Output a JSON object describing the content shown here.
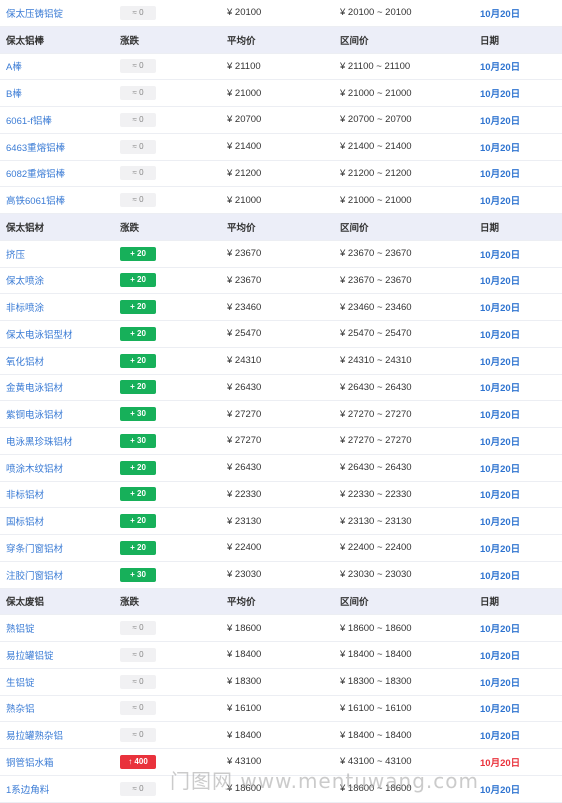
{
  "sections": [
    {
      "header": null,
      "rows": [
        {
          "name": "保太压铸铝锭",
          "change": "0",
          "dir": "flat",
          "avg": "¥ 20100",
          "range": "¥ 20100 ~ 20100",
          "date": "10月20日"
        }
      ]
    },
    {
      "header": {
        "name": "保太铝棒",
        "change": "涨跌",
        "avg": "平均价",
        "range": "区间价",
        "date": "日期"
      },
      "rows": [
        {
          "name": "A棒",
          "change": "0",
          "dir": "flat",
          "avg": "¥ 21100",
          "range": "¥ 21100 ~ 21100",
          "date": "10月20日"
        },
        {
          "name": "B棒",
          "change": "0",
          "dir": "flat",
          "avg": "¥ 21000",
          "range": "¥ 21000 ~ 21000",
          "date": "10月20日"
        },
        {
          "name": "6061-f铝棒",
          "change": "0",
          "dir": "flat",
          "avg": "¥ 20700",
          "range": "¥ 20700 ~ 20700",
          "date": "10月20日"
        },
        {
          "name": "6463重熔铝棒",
          "change": "0",
          "dir": "flat",
          "avg": "¥ 21400",
          "range": "¥ 21400 ~ 21400",
          "date": "10月20日"
        },
        {
          "name": "6082重熔铝棒",
          "change": "0",
          "dir": "flat",
          "avg": "¥ 21200",
          "range": "¥ 21200 ~ 21200",
          "date": "10月20日"
        },
        {
          "name": "高铁6061铝棒",
          "change": "0",
          "dir": "flat",
          "avg": "¥ 21000",
          "range": "¥ 21000 ~ 21000",
          "date": "10月20日"
        }
      ]
    },
    {
      "header": {
        "name": "保太铝材",
        "change": "涨跌",
        "avg": "平均价",
        "range": "区间价",
        "date": "日期"
      },
      "rows": [
        {
          "name": "挤压",
          "change": "+ 20",
          "dir": "up",
          "avg": "¥ 23670",
          "range": "¥ 23670 ~ 23670",
          "date": "10月20日"
        },
        {
          "name": "保太喷涂",
          "change": "+ 20",
          "dir": "up",
          "avg": "¥ 23670",
          "range": "¥ 23670 ~ 23670",
          "date": "10月20日"
        },
        {
          "name": "非标喷涂",
          "change": "+ 20",
          "dir": "up",
          "avg": "¥ 23460",
          "range": "¥ 23460 ~ 23460",
          "date": "10月20日"
        },
        {
          "name": "保太电泳铝型材",
          "change": "+ 20",
          "dir": "up",
          "avg": "¥ 25470",
          "range": "¥ 25470 ~ 25470",
          "date": "10月20日"
        },
        {
          "name": "氧化铝材",
          "change": "+ 20",
          "dir": "up",
          "avg": "¥ 24310",
          "range": "¥ 24310 ~ 24310",
          "date": "10月20日"
        },
        {
          "name": "金黄电泳铝材",
          "change": "+ 20",
          "dir": "up",
          "avg": "¥ 26430",
          "range": "¥ 26430 ~ 26430",
          "date": "10月20日"
        },
        {
          "name": "紫铜电泳铝材",
          "change": "+ 30",
          "dir": "up",
          "avg": "¥ 27270",
          "range": "¥ 27270 ~ 27270",
          "date": "10月20日"
        },
        {
          "name": "电泳黑珍珠铝材",
          "change": "+ 30",
          "dir": "up",
          "avg": "¥ 27270",
          "range": "¥ 27270 ~ 27270",
          "date": "10月20日"
        },
        {
          "name": "喷涂木纹铝材",
          "change": "+ 20",
          "dir": "up",
          "avg": "¥ 26430",
          "range": "¥ 26430 ~ 26430",
          "date": "10月20日"
        },
        {
          "name": "非标铝材",
          "change": "+ 20",
          "dir": "up",
          "avg": "¥ 22330",
          "range": "¥ 22330 ~ 22330",
          "date": "10月20日"
        },
        {
          "name": "国标铝材",
          "change": "+ 20",
          "dir": "up",
          "avg": "¥ 23130",
          "range": "¥ 23130 ~ 23130",
          "date": "10月20日"
        },
        {
          "name": "穿条门窗铝材",
          "change": "+ 20",
          "dir": "up",
          "avg": "¥ 22400",
          "range": "¥ 22400 ~ 22400",
          "date": "10月20日"
        },
        {
          "name": "注胶门窗铝材",
          "change": "+ 30",
          "dir": "up",
          "avg": "¥ 23030",
          "range": "¥ 23030 ~ 23030",
          "date": "10月20日"
        }
      ]
    },
    {
      "header": {
        "name": "保太废铝",
        "change": "涨跌",
        "avg": "平均价",
        "range": "区间价",
        "date": "日期"
      },
      "rows": [
        {
          "name": "熟铝锭",
          "change": "0",
          "dir": "flat",
          "avg": "¥ 18600",
          "range": "¥ 18600 ~ 18600",
          "date": "10月20日"
        },
        {
          "name": "易拉罐铝锭",
          "change": "0",
          "dir": "flat",
          "avg": "¥ 18400",
          "range": "¥ 18400 ~ 18400",
          "date": "10月20日"
        },
        {
          "name": "生铝锭",
          "change": "0",
          "dir": "flat",
          "avg": "¥ 18300",
          "range": "¥ 18300 ~ 18300",
          "date": "10月20日"
        },
        {
          "name": "熟杂铝",
          "change": "0",
          "dir": "flat",
          "avg": "¥ 16100",
          "range": "¥ 16100 ~ 16100",
          "date": "10月20日"
        },
        {
          "name": "易拉罐熟杂铝",
          "change": "0",
          "dir": "flat",
          "avg": "¥ 18400",
          "range": "¥ 18400 ~ 18400",
          "date": "10月20日"
        },
        {
          "name": "铜管铝水箱",
          "change": "↑ 400",
          "dir": "up2",
          "avg": "¥ 43100",
          "range": "¥ 43100 ~ 43100",
          "date": "10月20日",
          "dateRed": true
        },
        {
          "name": "1系边角料",
          "change": "0",
          "dir": "flat",
          "avg": "¥ 18600",
          "range": "¥ 18600 ~ 18600",
          "date": "10月20日"
        }
      ]
    }
  ],
  "watermark": "门图网 www.mentuwang.com"
}
